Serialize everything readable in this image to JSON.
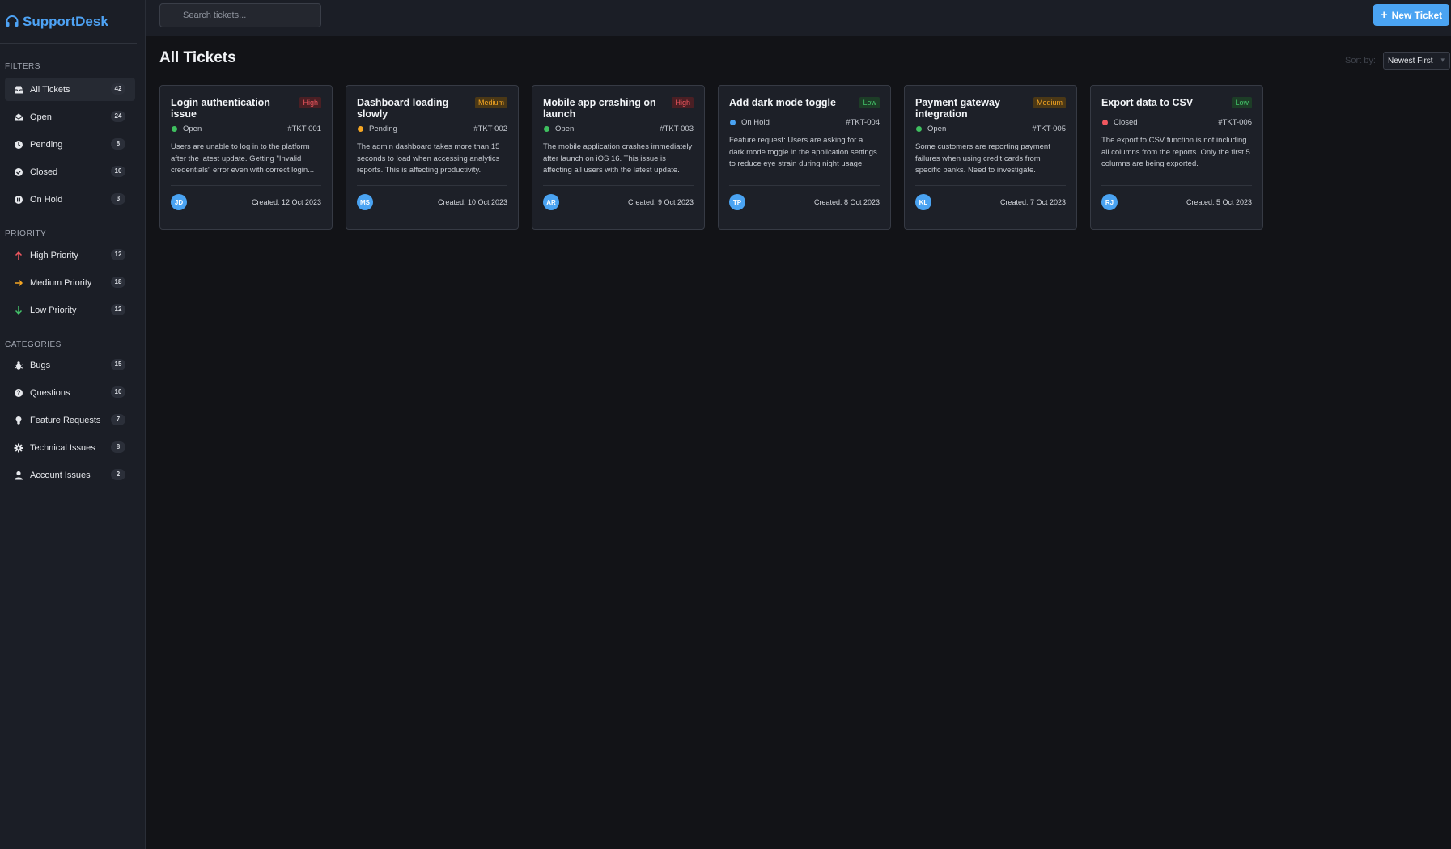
{
  "app": {
    "name": "SupportDesk"
  },
  "search": {
    "placeholder": "Search tickets..."
  },
  "header": {
    "new_ticket_label": "New Ticket"
  },
  "main": {
    "title": "All Tickets",
    "sort_label": "Sort by:",
    "sort_value": "Newest First"
  },
  "sidebar": {
    "filters_title": "FILTERS",
    "filters": [
      {
        "label": "All Tickets",
        "count": "42",
        "icon": "inbox-icon",
        "active": true
      },
      {
        "label": "Open",
        "count": "24",
        "icon": "envelope-open-icon"
      },
      {
        "label": "Pending",
        "count": "8",
        "icon": "clock-icon"
      },
      {
        "label": "Closed",
        "count": "10",
        "icon": "check-circle-icon"
      },
      {
        "label": "On Hold",
        "count": "3",
        "icon": "pause-circle-icon"
      }
    ],
    "priority_title": "PRIORITY",
    "priority": [
      {
        "label": "High Priority",
        "count": "12",
        "icon": "arrow-up-icon",
        "color": "#f0575f"
      },
      {
        "label": "Medium Priority",
        "count": "18",
        "icon": "arrow-right-icon",
        "color": "#f5a623"
      },
      {
        "label": "Low Priority",
        "count": "12",
        "icon": "arrow-down-icon",
        "color": "#44c46a"
      }
    ],
    "categories_title": "CATEGORIES",
    "categories": [
      {
        "label": "Bugs",
        "count": "15",
        "icon": "bug-icon"
      },
      {
        "label": "Questions",
        "count": "10",
        "icon": "question-circle-icon"
      },
      {
        "label": "Feature Requests",
        "count": "7",
        "icon": "lightbulb-icon"
      },
      {
        "label": "Technical Issues",
        "count": "8",
        "icon": "gear-icon"
      },
      {
        "label": "Account Issues",
        "count": "2",
        "icon": "user-icon"
      }
    ]
  },
  "tickets": [
    {
      "title": "Login authentication issue",
      "priority": "High",
      "status": "Open",
      "status_color": "#3fbf5f",
      "id": "#TKT-001",
      "description": "Users are unable to log in to the platform after the latest update. Getting \"Invalid credentials\" error even with correct login...",
      "initials": "JD",
      "created": "Created: 12 Oct 2023"
    },
    {
      "title": "Dashboard loading slowly",
      "priority": "Medium",
      "status": "Pending",
      "status_color": "#f5a623",
      "id": "#TKT-002",
      "description": "The admin dashboard takes more than 15 seconds to load when accessing analytics reports. This is affecting productivity.",
      "initials": "MS",
      "created": "Created: 10 Oct 2023"
    },
    {
      "title": "Mobile app crashing on launch",
      "priority": "High",
      "status": "Open",
      "status_color": "#3fbf5f",
      "id": "#TKT-003",
      "description": "The mobile application crashes immediately after launch on iOS 16. This issue is affecting all users with the latest update.",
      "initials": "AR",
      "created": "Created: 9 Oct 2023"
    },
    {
      "title": "Add dark mode toggle",
      "priority": "Low",
      "status": "On Hold",
      "status_color": "#4aa3f2",
      "id": "#TKT-004",
      "description": "Feature request: Users are asking for a dark mode toggle in the application settings to reduce eye strain during night usage.",
      "initials": "TP",
      "created": "Created: 8 Oct 2023"
    },
    {
      "title": "Payment gateway integration",
      "priority": "Medium",
      "status": "Open",
      "status_color": "#3fbf5f",
      "id": "#TKT-005",
      "description": "Some customers are reporting payment failures when using credit cards from specific banks. Need to investigate.",
      "initials": "KL",
      "created": "Created: 7 Oct 2023"
    },
    {
      "title": "Export data to CSV",
      "priority": "Low",
      "status": "Closed",
      "status_color": "#f0575f",
      "id": "#TKT-006",
      "description": "The export to CSV function is not including all columns from the reports. Only the first 5 columns are being exported.",
      "initials": "RJ",
      "created": "Created: 5 Oct 2023"
    }
  ]
}
